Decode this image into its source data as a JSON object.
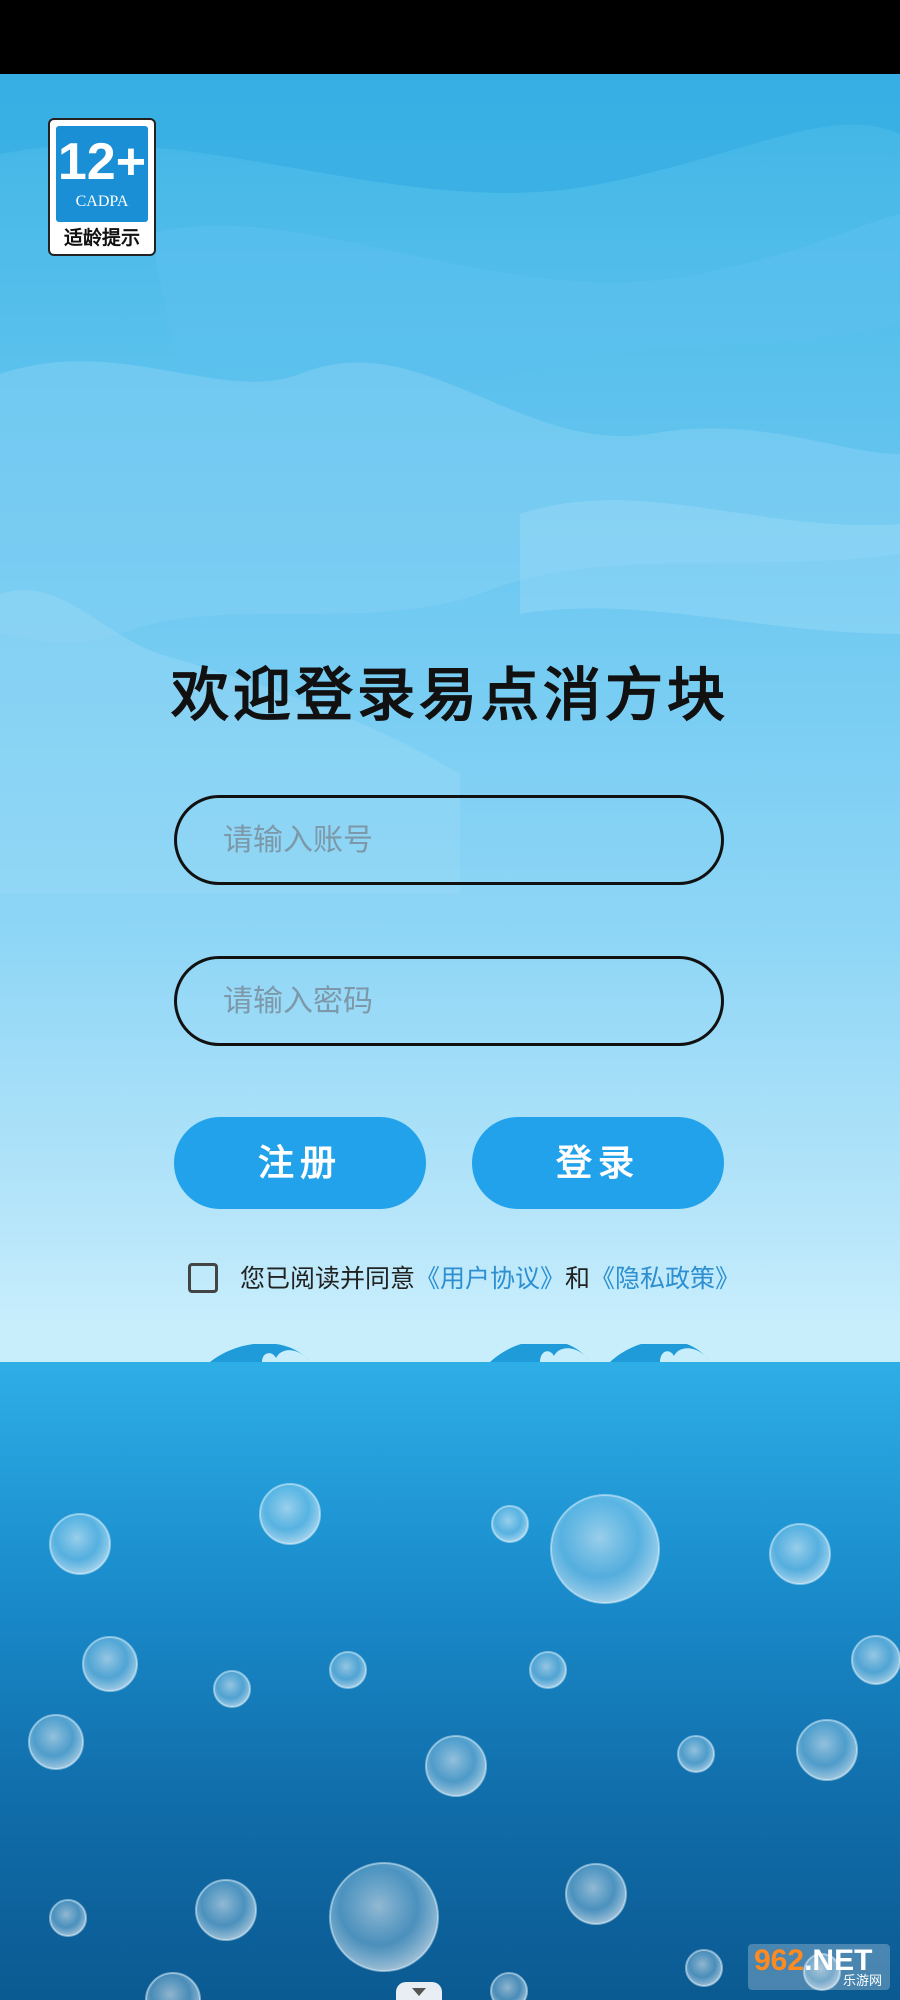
{
  "age_rating": {
    "number": "12+",
    "organization": "CADPA",
    "hint": "适龄提示"
  },
  "login": {
    "title": "欢迎登录易点消方块",
    "account_placeholder": "请输入账号",
    "password_placeholder": "请输入密码",
    "register_label": "注册",
    "login_label": "登录"
  },
  "agreement": {
    "prefix": "您已阅读并同意",
    "user_agreement": "《用户协议》",
    "conjunction": "和",
    "privacy_policy": "《隐私政策》",
    "checked": false
  },
  "watermark": {
    "number": "962",
    "suffix": ".NET",
    "subtitle": "乐游网"
  },
  "colors": {
    "button": "#22a2ea",
    "link": "#2d8fd0",
    "sky_top": "#3fb5e6",
    "sea": "#1d8dcc"
  }
}
